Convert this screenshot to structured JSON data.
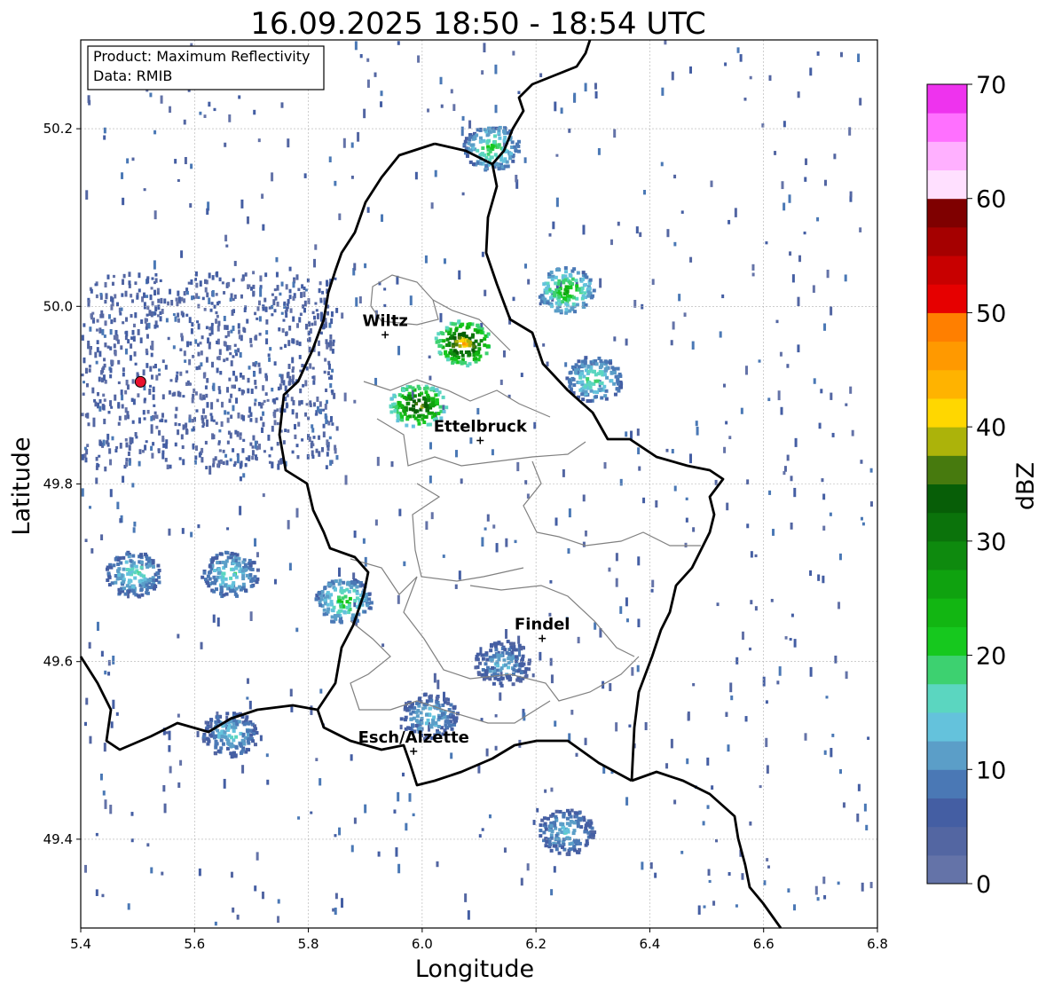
{
  "title": "16.09.2025 18:50 - 18:54 UTC",
  "info_box": {
    "product": "Product: Maximum Reflectivity",
    "data": "Data: RMIB"
  },
  "axes": {
    "xlabel": "Longitude",
    "ylabel": "Latitude",
    "xlim": [
      5.4,
      6.8
    ],
    "ylim": [
      49.3,
      50.3
    ],
    "xticks": [
      5.4,
      5.6,
      5.8,
      6.0,
      6.2,
      6.4,
      6.6,
      6.8
    ],
    "xtick_labels": [
      "5.4",
      "5.6",
      "5.8",
      "6.0",
      "6.2",
      "6.4",
      "6.6",
      "6.8"
    ],
    "yticks": [
      49.4,
      49.6,
      49.8,
      50.0,
      50.2
    ],
    "ytick_labels": [
      "49.4",
      "49.6",
      "49.8",
      "50.0",
      "50.2"
    ],
    "grid": true
  },
  "colorbar": {
    "label": "dBZ",
    "min": 0,
    "max": 70,
    "step": 2.5,
    "ticks": [
      0,
      10,
      20,
      30,
      40,
      50,
      60,
      70
    ],
    "tick_labels": [
      "0",
      "10",
      "20",
      "30",
      "40",
      "50",
      "60",
      "70"
    ],
    "colors": [
      "#6473a8",
      "#5366a2",
      "#445ea3",
      "#4a78b5",
      "#5b9ec8",
      "#64c2dc",
      "#5bd6c0",
      "#3dd170",
      "#16c81e",
      "#12b612",
      "#0fa20f",
      "#0e8a0e",
      "#0b730b",
      "#075e07",
      "#477a0e",
      "#acb30a",
      "#ffd700",
      "#ffb300",
      "#ff9900",
      "#ff7f00",
      "#e60000",
      "#c80000",
      "#a50000",
      "#7f0000",
      "#ffe0ff",
      "#ffb0ff",
      "#ff70ff",
      "#ee33ee"
    ]
  },
  "cities": [
    {
      "name": "Wiltz",
      "lon": 5.935,
      "lat": 49.968
    },
    {
      "name": "Ettelbruck",
      "lon": 6.102,
      "lat": 49.849
    },
    {
      "name": "Findel",
      "lon": 6.211,
      "lat": 49.626
    },
    {
      "name": "Esch/Alzette",
      "lon": 5.985,
      "lat": 49.499
    }
  ],
  "radar_site": {
    "lon": 5.505,
    "lat": 49.915,
    "color": "#e8112d"
  },
  "map_colors": {
    "national_border": "#000000",
    "district_border": "#808080"
  },
  "echo_cells": [
    {
      "lon": 5.49,
      "lat": 49.7,
      "dbz": 18
    },
    {
      "lon": 5.66,
      "lat": 49.7,
      "dbz": 18
    },
    {
      "lon": 5.86,
      "lat": 49.67,
      "dbz": 22
    },
    {
      "lon": 6.01,
      "lat": 49.54,
      "dbz": 15
    },
    {
      "lon": 6.25,
      "lat": 50.02,
      "dbz": 26
    },
    {
      "lon": 6.12,
      "lat": 50.18,
      "dbz": 22
    },
    {
      "lon": 6.3,
      "lat": 49.92,
      "dbz": 20
    },
    {
      "lon": 5.66,
      "lat": 49.52,
      "dbz": 16
    },
    {
      "lon": 6.25,
      "lat": 49.41,
      "dbz": 15
    },
    {
      "lon": 6.14,
      "lat": 49.6,
      "dbz": 13
    },
    {
      "lon": 6.07,
      "lat": 49.96,
      "dbz": 45
    },
    {
      "lon": 5.99,
      "lat": 49.89,
      "dbz": 40
    }
  ]
}
